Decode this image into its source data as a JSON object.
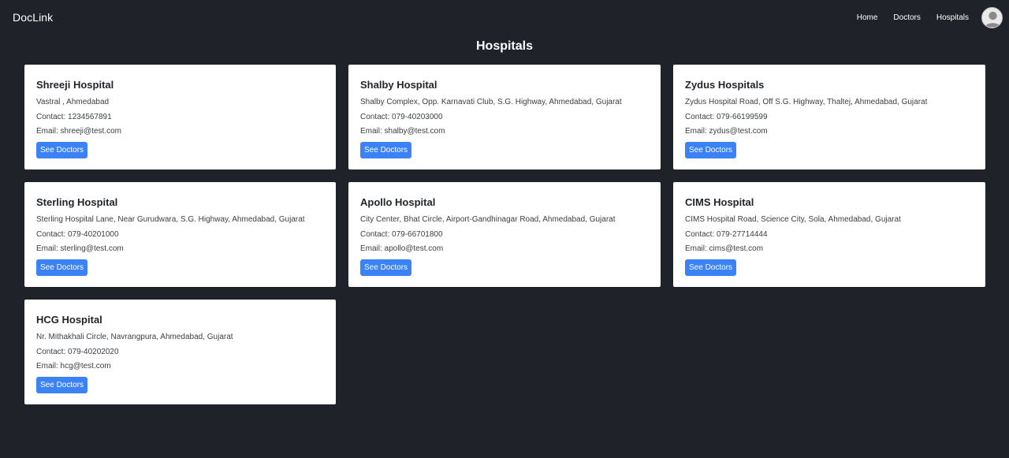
{
  "nav": {
    "brand": "DocLink",
    "links": [
      "Home",
      "Doctors",
      "Hospitals"
    ]
  },
  "page": {
    "title": "Hospitals"
  },
  "hospitals": [
    {
      "name": "Shreeji Hospital",
      "address": "Vastral , Ahmedabad",
      "contact": "Contact: 1234567891",
      "email": "Email: shreeji@test.com",
      "button": "See Doctors"
    },
    {
      "name": "Shalby Hospital",
      "address": "Shalby Complex, Opp. Karnavati Club, S.G. Highway, Ahmedabad, Gujarat",
      "contact": "Contact: 079-40203000",
      "email": "Email: shalby@test.com",
      "button": "See Doctors"
    },
    {
      "name": "Zydus Hospitals",
      "address": "Zydus Hospital Road, Off S.G. Highway, Thaltej, Ahmedabad, Gujarat",
      "contact": "Contact: 079-66199599",
      "email": "Email: zydus@test.com",
      "button": "See Doctors"
    },
    {
      "name": "Sterling Hospital",
      "address": "Sterling Hospital Lane, Near Gurudwara, S.G. Highway, Ahmedabad, Gujarat",
      "contact": "Contact: 079-40201000",
      "email": "Email: sterling@test.com",
      "button": "See Doctors"
    },
    {
      "name": "Apollo Hospital",
      "address": "City Center, Bhat Circle, Airport-Gandhinagar Road, Ahmedabad, Gujarat",
      "contact": "Contact: 079-66701800",
      "email": "Email: apollo@test.com",
      "button": "See Doctors"
    },
    {
      "name": "CIMS Hospital",
      "address": "CIMS Hospital Road, Science City, Sola, Ahmedabad, Gujarat",
      "contact": "Contact: 079-27714444",
      "email": "Email: cims@test.com",
      "button": "See Doctors"
    },
    {
      "name": "HCG Hospital",
      "address": "Nr. Mithakhali Circle, Navrangpura, Ahmedabad, Gujarat",
      "contact": "Contact: 079-40202020",
      "email": "Email: hcg@test.com",
      "button": "See Doctors"
    }
  ]
}
